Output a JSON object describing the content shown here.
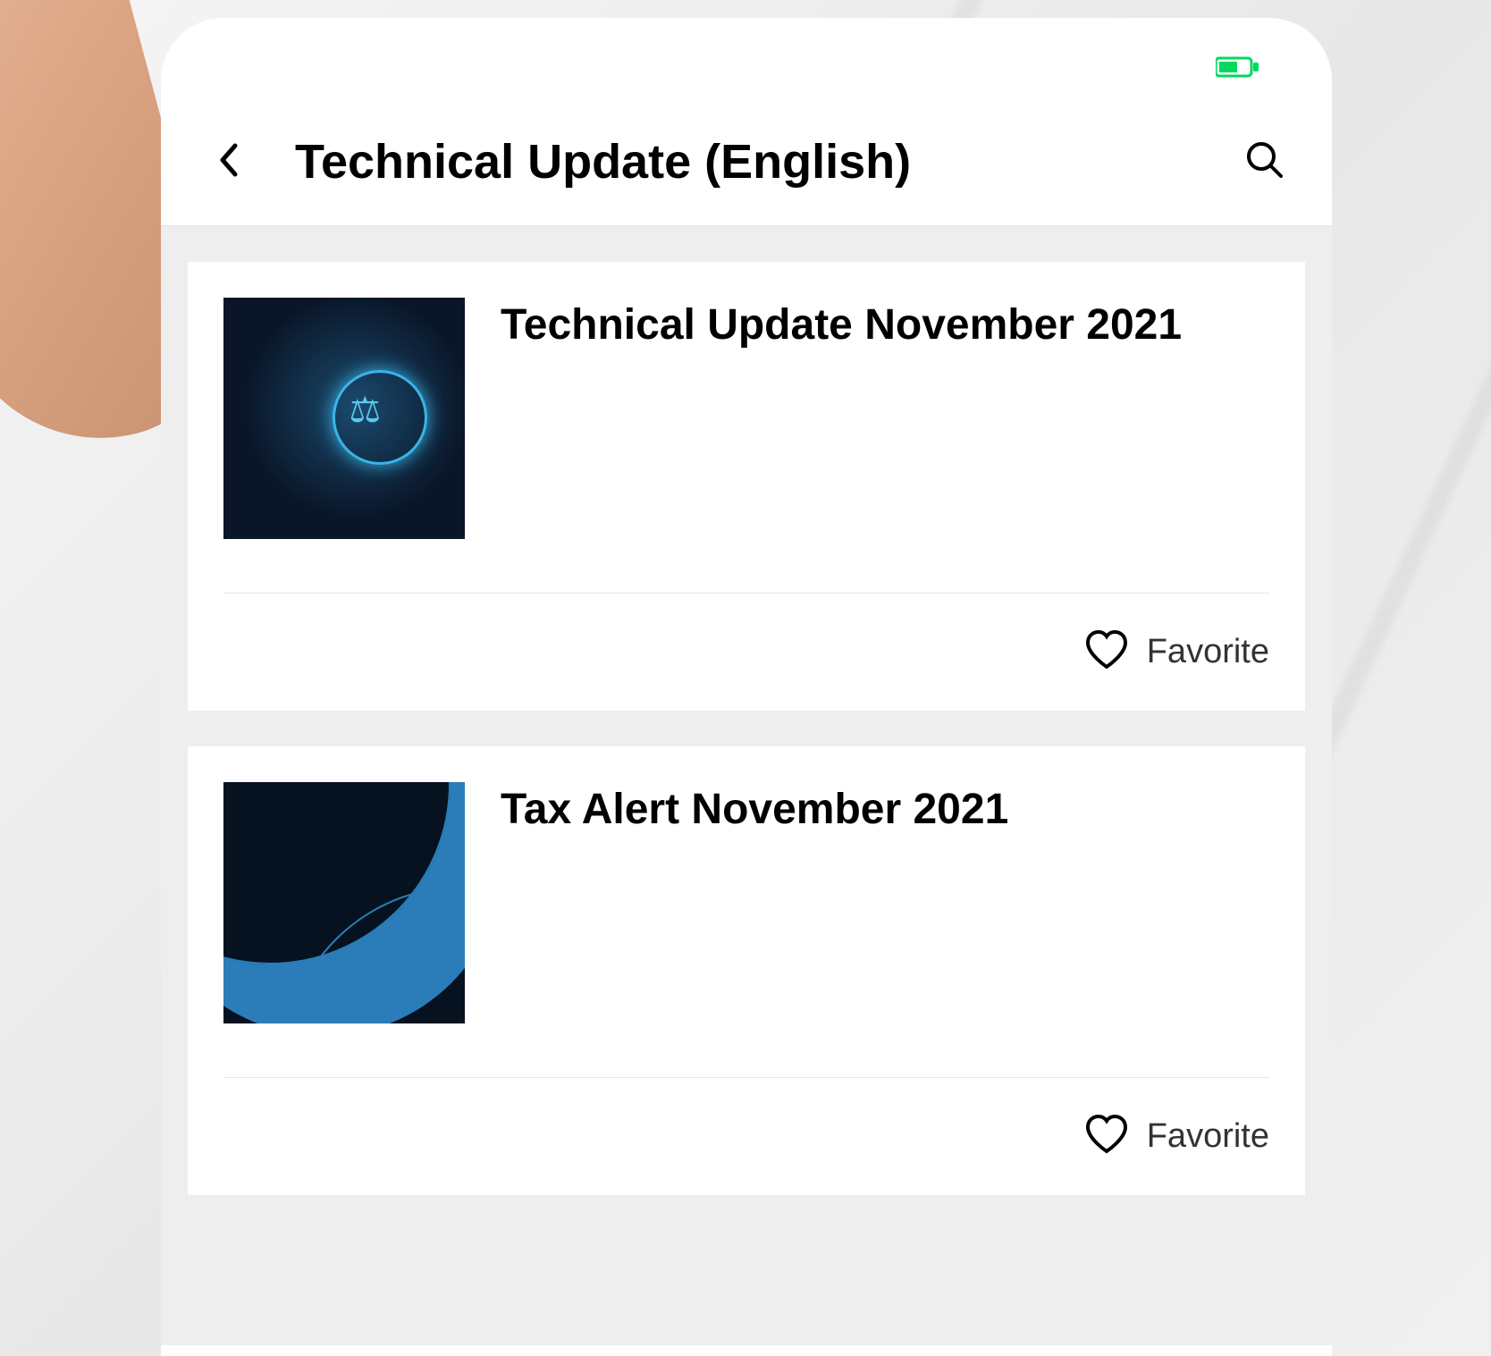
{
  "header": {
    "title": "Technical Update (English)"
  },
  "articles": [
    {
      "title": "Technical Update November 2021",
      "favorite_label": "Favorite"
    },
    {
      "title": "Tax Alert November 2021",
      "favorite_label": "Favorite"
    }
  ]
}
